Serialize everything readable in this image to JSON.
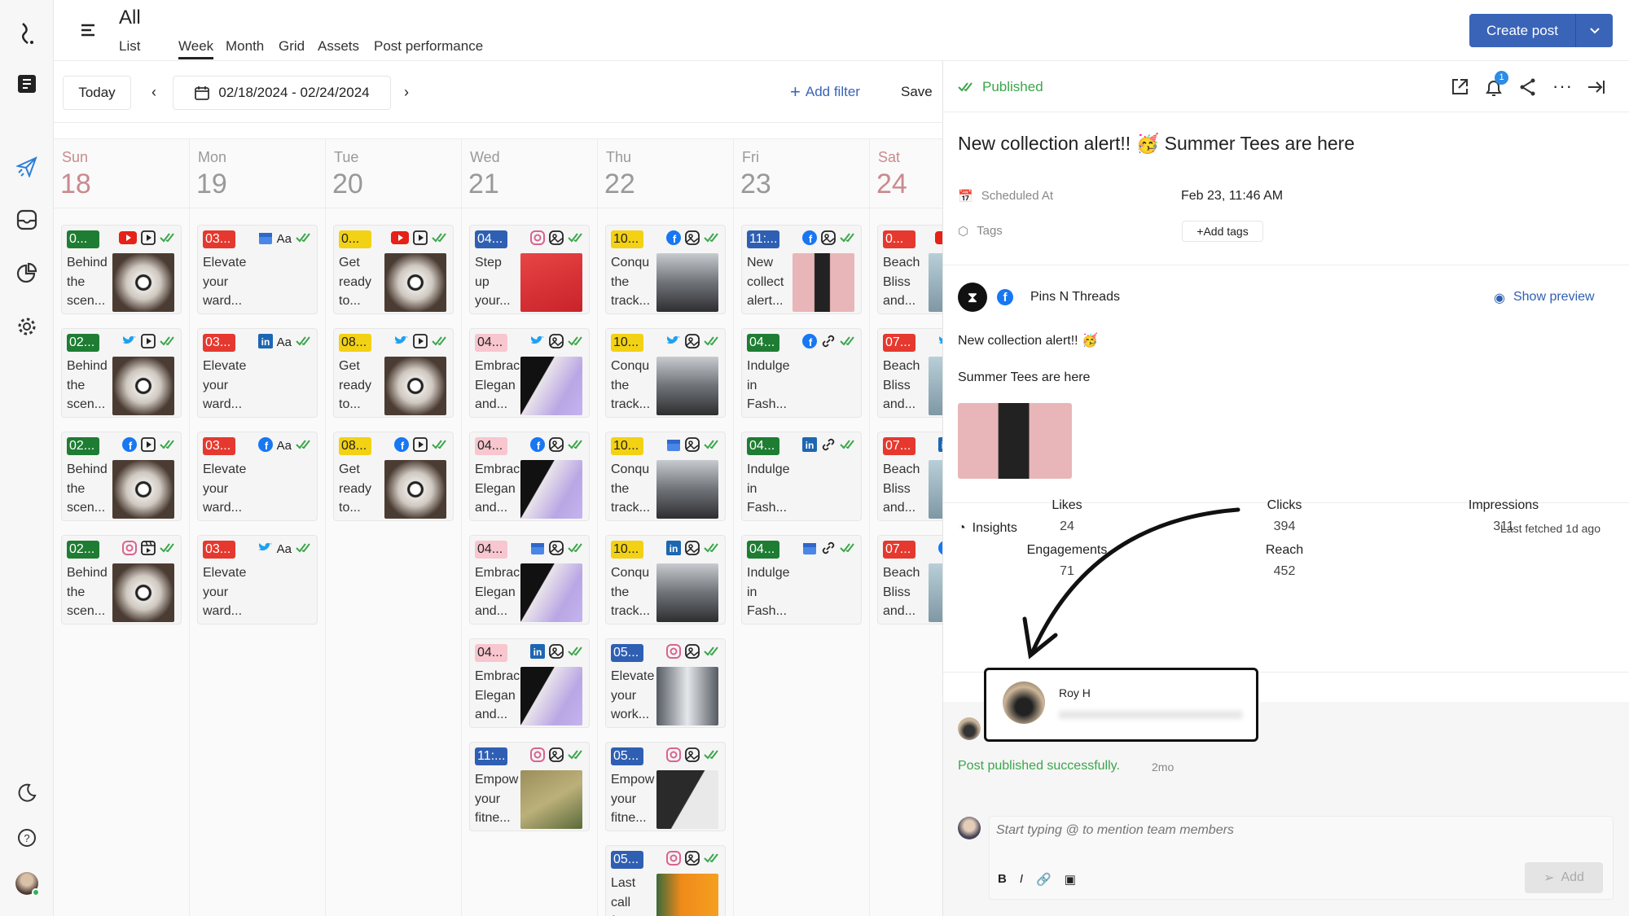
{
  "colors": {
    "accent": "#3a64b8",
    "published": "#3aa64a",
    "badge_green": "#1e7d32",
    "badge_red": "#e5392f",
    "badge_yellow": "#f3d114",
    "badge_blue": "#2f5fb3",
    "badge_pink": "#f8c6cf"
  },
  "sidebar": {
    "items": [
      "logo-icon",
      "drafts-icon",
      "publish-icon",
      "inbox-icon",
      "analytics-icon",
      "settings-icon",
      "dark-mode-icon",
      "help-icon",
      "user-avatar"
    ]
  },
  "header": {
    "title": "All",
    "tabs": [
      "List",
      "Week",
      "Month",
      "Grid",
      "Assets",
      "Post performance"
    ],
    "active_tab": "Week",
    "create_label": "Create post"
  },
  "toolbar": {
    "today": "Today",
    "date_range": "02/18/2024 - 02/24/2024",
    "add_filter": "Add filter",
    "save": "Save"
  },
  "calendar": {
    "days": [
      {
        "name": "Sun",
        "num": "18",
        "posts": [
          {
            "time": "0...",
            "color": "green",
            "net": "youtube",
            "type": "video",
            "text": [
              "Behind",
              "the",
              "scen..."
            ],
            "thumb": "studio"
          },
          {
            "time": "02...",
            "color": "green",
            "net": "twitter",
            "type": "video",
            "text": [
              "Behind",
              "the",
              "scen..."
            ],
            "thumb": "studio"
          },
          {
            "time": "02...",
            "color": "green",
            "net": "facebook",
            "type": "video",
            "text": [
              "Behind",
              "the",
              "scen..."
            ],
            "thumb": "studio"
          },
          {
            "time": "02...",
            "color": "green",
            "net": "instagram",
            "type": "reel",
            "text": [
              "Behind",
              "the",
              "scen..."
            ],
            "thumb": "studio"
          }
        ]
      },
      {
        "name": "Mon",
        "num": "19",
        "posts": [
          {
            "time": "03...",
            "color": "red",
            "net": "gmb",
            "type": "text",
            "text": [
              "Elevate",
              "your",
              "ward..."
            ]
          },
          {
            "time": "03...",
            "color": "red",
            "net": "linkedin",
            "type": "text",
            "text": [
              "Elevate",
              "your",
              "ward..."
            ]
          },
          {
            "time": "03...",
            "color": "red",
            "net": "facebook",
            "type": "text",
            "text": [
              "Elevate",
              "your",
              "ward..."
            ]
          },
          {
            "time": "03...",
            "color": "red",
            "net": "twitter",
            "type": "text",
            "text": [
              "Elevate",
              "your",
              "ward..."
            ]
          }
        ]
      },
      {
        "name": "Tue",
        "num": "20",
        "posts": [
          {
            "time": "0...",
            "color": "yellow",
            "net": "youtube",
            "type": "video",
            "text": [
              "Get",
              "ready",
              "to..."
            ],
            "thumb": "studio"
          },
          {
            "time": "08...",
            "color": "yellow",
            "net": "twitter",
            "type": "video",
            "text": [
              "Get",
              "ready",
              "to..."
            ],
            "thumb": "studio"
          },
          {
            "time": "08...",
            "color": "yellow",
            "net": "facebook",
            "type": "video",
            "text": [
              "Get",
              "ready",
              "to..."
            ],
            "thumb": "studio"
          }
        ]
      },
      {
        "name": "Wed",
        "num": "21",
        "posts": [
          {
            "time": "04...",
            "color": "blue",
            "net": "instagram",
            "type": "image",
            "text": [
              "Step",
              "up",
              "your..."
            ],
            "thumb": "red"
          },
          {
            "time": "04...",
            "color": "pink",
            "net": "twitter",
            "type": "image",
            "text": [
              "Embrac",
              "Elegan",
              "and..."
            ],
            "thumb": "dress"
          },
          {
            "time": "04...",
            "color": "pink",
            "net": "facebook",
            "type": "image",
            "text": [
              "Embrac",
              "Elegan",
              "and..."
            ],
            "thumb": "dress"
          },
          {
            "time": "04...",
            "color": "pink",
            "net": "gmb",
            "type": "image",
            "text": [
              "Embrac",
              "Elegan",
              "and..."
            ],
            "thumb": "dress"
          },
          {
            "time": "04...",
            "color": "pink",
            "net": "linkedin",
            "type": "image",
            "text": [
              "Embrac",
              "Elegan",
              "and..."
            ],
            "thumb": "dress"
          },
          {
            "time": "11:...",
            "color": "blue",
            "net": "instagram",
            "type": "image",
            "text": [
              "Empow",
              "your",
              "fitne..."
            ],
            "thumb": "field"
          }
        ]
      },
      {
        "name": "Thu",
        "num": "22",
        "posts": [
          {
            "time": "10...",
            "color": "yellow",
            "net": "facebook",
            "type": "image",
            "text": [
              "Conqu",
              "the",
              "track..."
            ],
            "thumb": "shoe"
          },
          {
            "time": "10...",
            "color": "yellow",
            "net": "twitter",
            "type": "image",
            "text": [
              "Conqu",
              "the",
              "track..."
            ],
            "thumb": "shoe"
          },
          {
            "time": "10...",
            "color": "yellow",
            "net": "gmb",
            "type": "image",
            "text": [
              "Conqu",
              "the",
              "track..."
            ],
            "thumb": "shoe"
          },
          {
            "time": "10...",
            "color": "yellow",
            "net": "linkedin",
            "type": "image",
            "text": [
              "Conqu",
              "the",
              "track..."
            ],
            "thumb": "shoe"
          },
          {
            "time": "05...",
            "color": "blue",
            "net": "instagram",
            "type": "image",
            "text": [
              "Elevate",
              "your",
              "work..."
            ],
            "thumb": "gray"
          },
          {
            "time": "05...",
            "color": "blue",
            "net": "instagram",
            "type": "image",
            "text": [
              "Empow",
              "your",
              "fitne..."
            ],
            "thumb": "gym"
          },
          {
            "time": "05...",
            "color": "blue",
            "net": "instagram",
            "type": "image",
            "text": [
              "Last",
              "call",
              "f..."
            ],
            "thumb": "sale"
          }
        ]
      },
      {
        "name": "Fri",
        "num": "23",
        "posts": [
          {
            "time": "11:...",
            "color": "blue",
            "net": "facebook",
            "type": "image",
            "text": [
              "New",
              "collect",
              "alert..."
            ],
            "thumb": "pink"
          },
          {
            "time": "04...",
            "color": "green",
            "net": "facebook",
            "type": "link",
            "text": [
              "Indulge",
              "in",
              "Fash..."
            ]
          },
          {
            "time": "04...",
            "color": "green",
            "net": "linkedin",
            "type": "link",
            "text": [
              "Indulge",
              "in",
              "Fash..."
            ]
          },
          {
            "time": "04...",
            "color": "green",
            "net": "gmb",
            "type": "link",
            "text": [
              "Indulge",
              "in",
              "Fash..."
            ]
          }
        ]
      },
      {
        "name": "Sat",
        "num": "24",
        "posts": [
          {
            "time": "0...",
            "color": "red",
            "net": "youtube",
            "type": "image",
            "text": [
              "Beach",
              "Bliss",
              "and..."
            ],
            "thumb": "beach"
          },
          {
            "time": "07...",
            "color": "red",
            "net": "twitter",
            "type": "image",
            "text": [
              "Beach",
              "Bliss",
              "and..."
            ],
            "thumb": "beach"
          },
          {
            "time": "07...",
            "color": "red",
            "net": "linkedin",
            "type": "image",
            "text": [
              "Beach",
              "Bliss",
              "and..."
            ],
            "thumb": "beach"
          },
          {
            "time": "07...",
            "color": "red",
            "net": "facebook",
            "type": "image",
            "text": [
              "Beach",
              "Bliss",
              "and..."
            ],
            "thumb": "beach"
          }
        ]
      }
    ]
  },
  "panel": {
    "status": "Published",
    "notification_count": "1",
    "title": "New collection alert!! 🥳 Summer Tees are here",
    "scheduled_label": "Scheduled At",
    "scheduled_value": "Feb 23, 11:46 AM",
    "tags_label": "Tags",
    "add_tags": "Add tags",
    "account": "Pins N Threads",
    "show_preview": "Show preview",
    "body_line1": "New collection alert!! 🥳",
    "body_line2": "Summer Tees are here",
    "insights_label": "Insights",
    "last_fetched": "Last fetched 1d ago",
    "metrics": [
      {
        "label": "Likes",
        "value": "24"
      },
      {
        "label": "Clicks",
        "value": "394"
      },
      {
        "label": "Impressions",
        "value": "311"
      },
      {
        "label": "Engagements",
        "value": "71"
      },
      {
        "label": "Reach",
        "value": "452"
      }
    ],
    "user_popup_name": "Roy H",
    "activity": "Post published successfully.",
    "activity_time": "2mo",
    "comment_placeholder": "Start typing @ to mention team members",
    "add_label": "Add"
  }
}
